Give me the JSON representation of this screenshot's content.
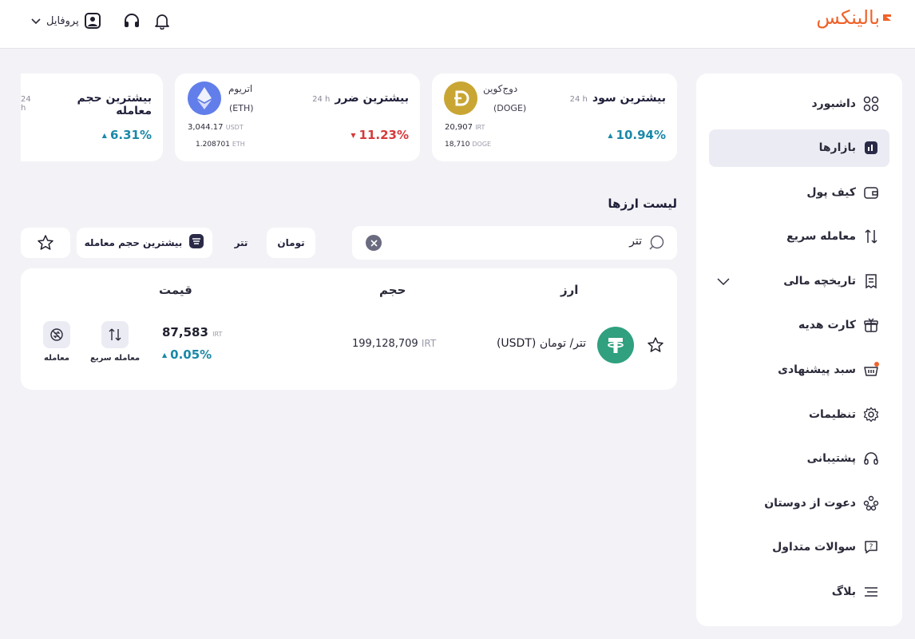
{
  "header": {
    "logo": "بالینکس",
    "profile_label": "پروفایل"
  },
  "colors": {
    "brand": "#f0622a",
    "up": "#1b88a8",
    "down": "#d63a3a",
    "active_bg": "#ebebf4",
    "tether_green": "#30a07e",
    "doge_gold": "#c9a633",
    "eth_blue": "#627eea"
  },
  "sidebar": {
    "items": [
      {
        "label": "داشبورد",
        "icon": "grid-icon"
      },
      {
        "label": "بازارها",
        "icon": "chart-icon"
      },
      {
        "label": "کیف پول",
        "icon": "wallet-icon"
      },
      {
        "label": "معامله سریع",
        "icon": "swap-icon"
      },
      {
        "label": "تاریخچه مالی",
        "icon": "receipt-icon"
      },
      {
        "label": "کارت هدیه",
        "icon": "gift-icon"
      },
      {
        "label": "سبد پیشنهادی",
        "icon": "basket-icon"
      },
      {
        "label": "تنظیمات",
        "icon": "gear-icon"
      },
      {
        "label": "پشتیبانی",
        "icon": "headset-icon"
      },
      {
        "label": "دعوت از دوستان",
        "icon": "people-icon"
      },
      {
        "label": "سوالات متداول",
        "icon": "question-icon"
      },
      {
        "label": "بلاگ",
        "icon": "menu-lines-icon"
      }
    ]
  },
  "stats": {
    "profit": {
      "title": "بیشترین سود",
      "period": "24 h",
      "change": "10.94%",
      "coin_name": "دوج‌کوین",
      "coin_symbol": "(DOGE)",
      "price": "20,907",
      "price_unit": "IRT",
      "secondary": "18,710",
      "secondary_unit": "DOGE"
    },
    "loss": {
      "title": "بیشترین ضرر",
      "period": "24 h",
      "change": "11.23%",
      "coin_name": "اتریوم",
      "coin_symbol": "(ETH)",
      "price": "3,044.17",
      "price_unit": "USDT",
      "secondary": "1.208701",
      "secondary_unit": "ETH"
    },
    "volume": {
      "title": "بیشترین حجم معامله",
      "period": "24 h",
      "change": "6.31%"
    }
  },
  "list": {
    "title": "لیست ارزها",
    "search_value": "تتر",
    "filters": {
      "toman": "تومان",
      "tether": "تتر",
      "sort": "بیشترین حجم معامله"
    },
    "columns": {
      "currency": "ارز",
      "volume": "حجم",
      "price": "قیمت"
    },
    "rows": [
      {
        "name": "تتر/ تومان",
        "symbol": "(USDT)",
        "volume": "199,128,709",
        "volume_unit": "IRT",
        "price": "87,583",
        "price_unit": "IRT",
        "change": "0.05%",
        "quick_trade": "معامله سریع",
        "trade": "معامله"
      }
    ]
  }
}
